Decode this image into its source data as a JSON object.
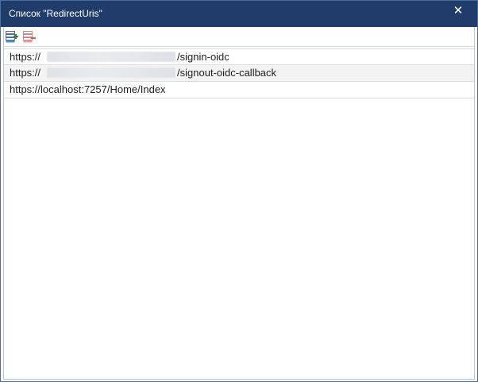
{
  "window": {
    "title": "Список \"RedirectUris\"",
    "close_label": "✕"
  },
  "toolbar": {
    "add_icon": "add-row-icon",
    "remove_icon": "remove-row-icon"
  },
  "rows": [
    {
      "prefix": "https://",
      "redacted": true,
      "suffix": "/signin-oidc"
    },
    {
      "prefix": "https://",
      "redacted": true,
      "suffix": "/signout-oidc-callback"
    },
    {
      "prefix": "https://localhost:7257/Home/Index",
      "redacted": false,
      "suffix": ""
    }
  ],
  "colors": {
    "titlebar": "#1f3c6b",
    "row_alt": "#f3f3f3",
    "add_icon_accent": "#2e8b3a",
    "remove_icon_accent": "#d9534f"
  }
}
